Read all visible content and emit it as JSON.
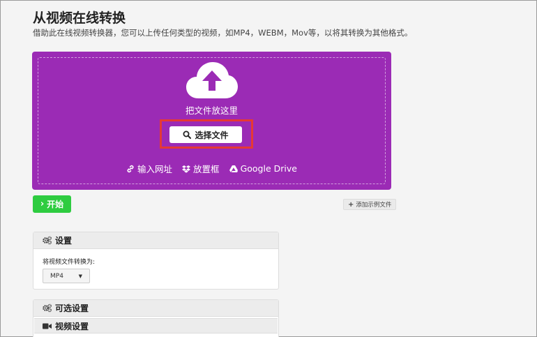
{
  "header": {
    "title": "从视频在线转换",
    "subtitle": "借助此在线视频转换器，您可以上传任何类型的视频，如MP4，WEBM，Mov等，以将其转换为其他格式。"
  },
  "dropzone": {
    "icon": "cloud-upload-icon",
    "drop_text": "把文件放这里",
    "choose_file_label": "选择文件",
    "sources": [
      {
        "icon": "link-icon",
        "label": "输入网址"
      },
      {
        "icon": "dropbox-icon",
        "label": "放置框"
      },
      {
        "icon": "google-drive-icon",
        "label": "Google Drive"
      }
    ],
    "accent_color": "#9b2bb5"
  },
  "actions": {
    "start_label": "开始",
    "add_sample_label": "添加示例文件",
    "start_color": "#2ecc40"
  },
  "settings": {
    "title": "设置",
    "convert_label": "将视频文件转换为:",
    "format_selected": "MP4"
  },
  "optional": {
    "title": "可选设置",
    "video_settings_title": "视频设置"
  }
}
